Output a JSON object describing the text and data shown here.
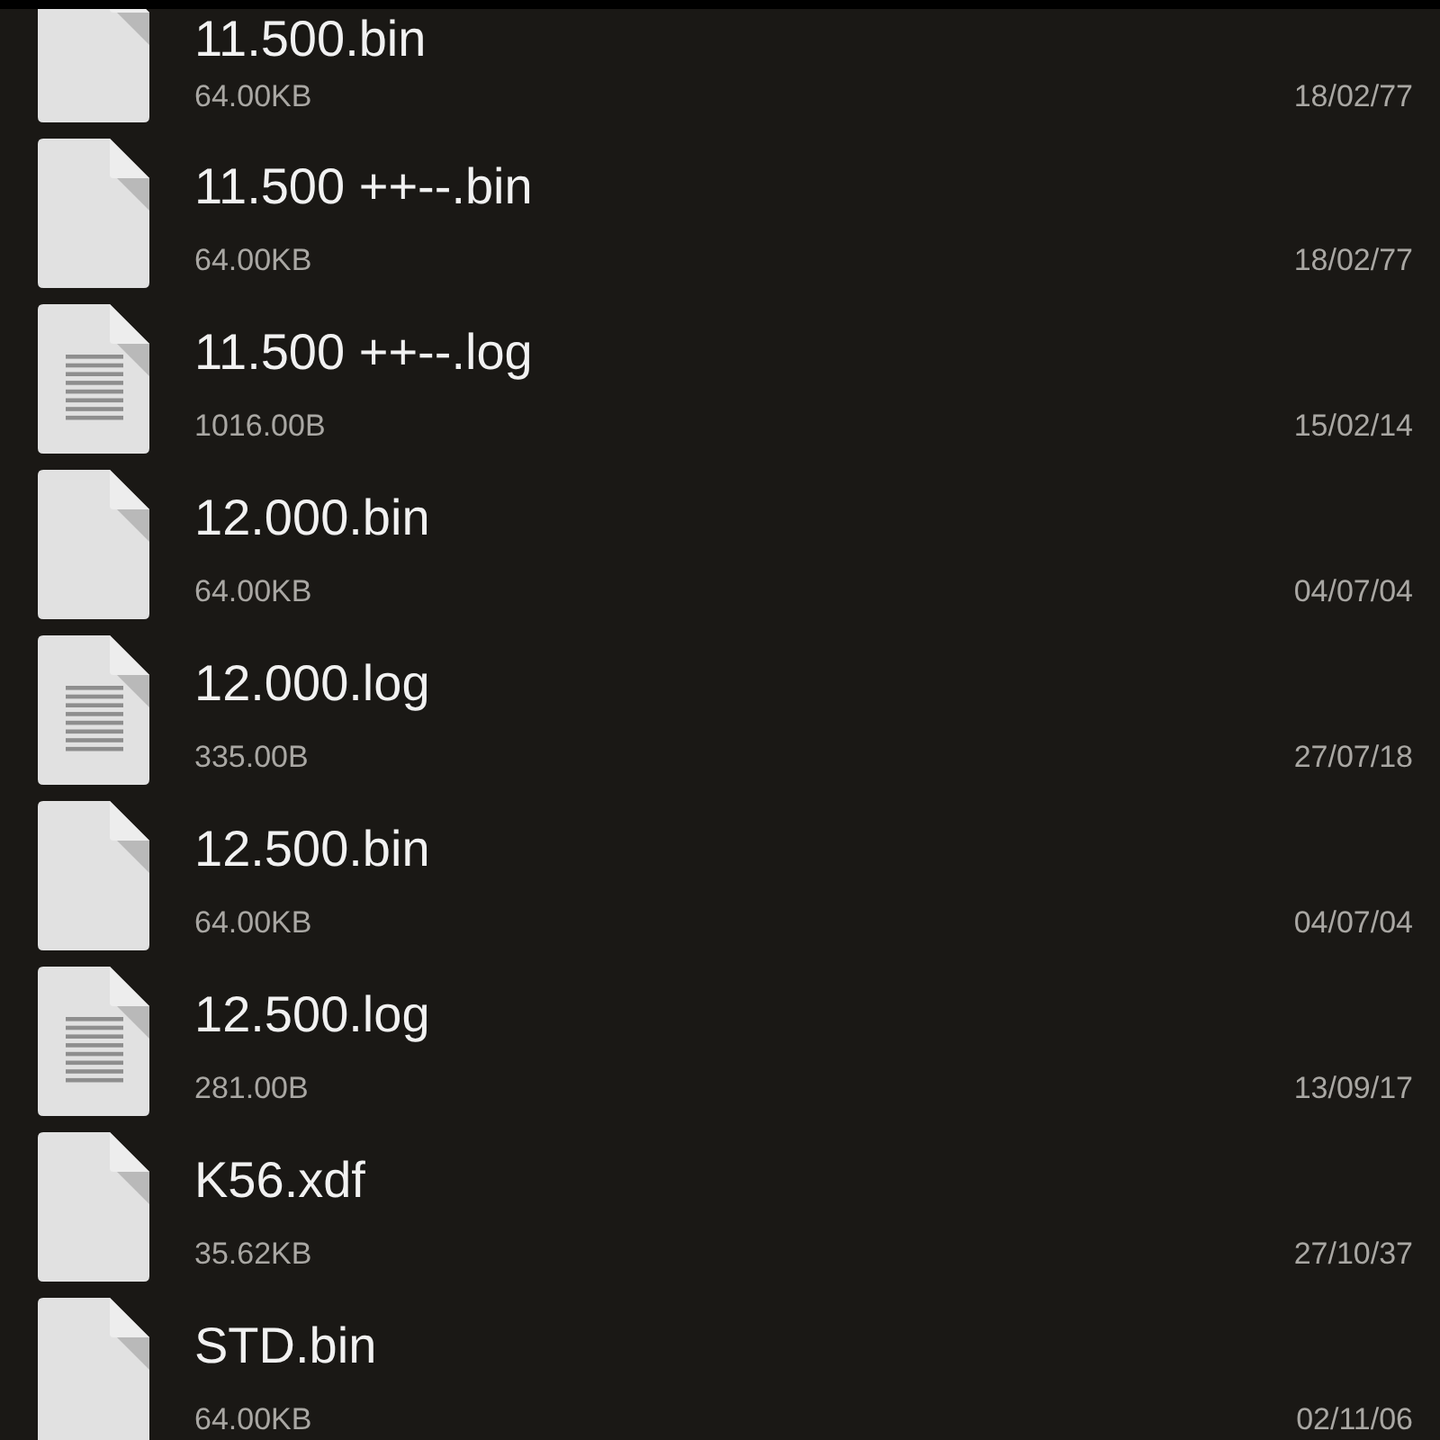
{
  "files": [
    {
      "name": "11.500.bin",
      "kind": "blank",
      "size": "64.00KB",
      "date": "18/02/77"
    },
    {
      "name": "11.500 ++--.bin",
      "kind": "blank",
      "size": "64.00KB",
      "date": "18/02/77"
    },
    {
      "name": "11.500 ++--.log",
      "kind": "text",
      "size": "1016.00B",
      "date": "15/02/14"
    },
    {
      "name": "12.000.bin",
      "kind": "blank",
      "size": "64.00KB",
      "date": "04/07/04"
    },
    {
      "name": "12.000.log",
      "kind": "text",
      "size": "335.00B",
      "date": "27/07/18"
    },
    {
      "name": "12.500.bin",
      "kind": "blank",
      "size": "64.00KB",
      "date": "04/07/04"
    },
    {
      "name": "12.500.log",
      "kind": "text",
      "size": "281.00B",
      "date": "13/09/17"
    },
    {
      "name": "K56.xdf",
      "kind": "blank",
      "size": "35.62KB",
      "date": "27/10/37"
    },
    {
      "name": "STD.bin",
      "kind": "blank",
      "size": "64.00KB",
      "date": "02/11/06"
    }
  ]
}
